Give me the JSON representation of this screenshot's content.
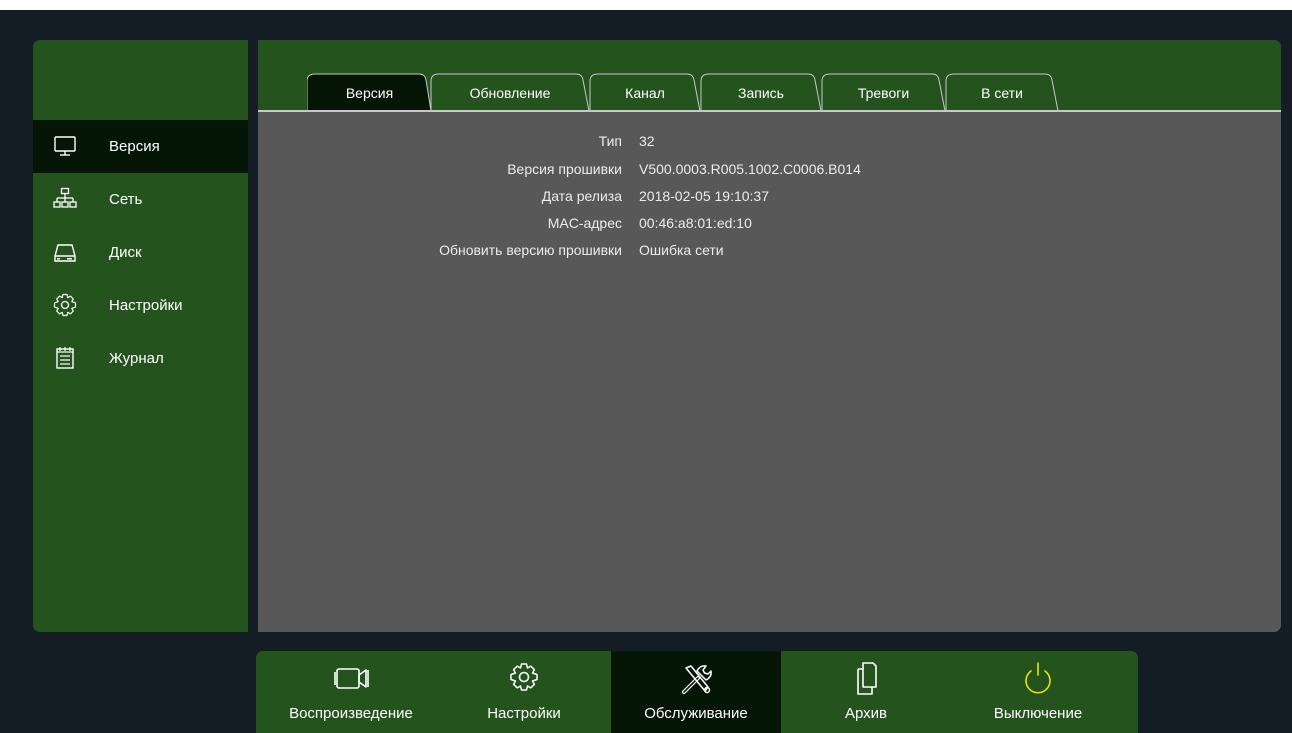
{
  "colors": {
    "panel_green": "#24531e",
    "active_dark": "#061606",
    "content_gray": "#585858",
    "background": "#151d24",
    "power_icon": "#e6e600"
  },
  "sidebar": {
    "items": [
      {
        "label": "Версия",
        "icon": "monitor-icon",
        "active": true
      },
      {
        "label": "Сеть",
        "icon": "network-icon",
        "active": false
      },
      {
        "label": "Диск",
        "icon": "disk-icon",
        "active": false
      },
      {
        "label": "Настройки",
        "icon": "gear-icon",
        "active": false
      },
      {
        "label": "Журнал",
        "icon": "log-icon",
        "active": false
      }
    ]
  },
  "tabs": [
    {
      "label": "Версия",
      "active": true
    },
    {
      "label": "Обновление",
      "active": false
    },
    {
      "label": "Канал",
      "active": false
    },
    {
      "label": "Запись",
      "active": false
    },
    {
      "label": "Тревоги",
      "active": false
    },
    {
      "label": "В сети",
      "active": false
    }
  ],
  "info": [
    {
      "key": "Тип",
      "value": "32"
    },
    {
      "key": "Версия прошивки",
      "value": "V500.0003.R005.1002.C0006.B014"
    },
    {
      "key": "Дата релиза",
      "value": "2018-02-05 19:10:37"
    },
    {
      "key": "MAC-адрес",
      "value": "00:46:a8:01:ed:10"
    },
    {
      "key": "Обновить версию прошивки",
      "value": "Ошибка сети"
    }
  ],
  "bottombar": {
    "items": [
      {
        "label": "Воспроизведение",
        "icon": "camera-icon",
        "active": false
      },
      {
        "label": "Настройки",
        "icon": "gear-icon",
        "active": false
      },
      {
        "label": "Обслуживание",
        "icon": "tools-icon",
        "active": true
      },
      {
        "label": "Архив",
        "icon": "archive-icon",
        "active": false
      },
      {
        "label": "Выключение",
        "icon": "power-icon",
        "active": false
      }
    ]
  }
}
